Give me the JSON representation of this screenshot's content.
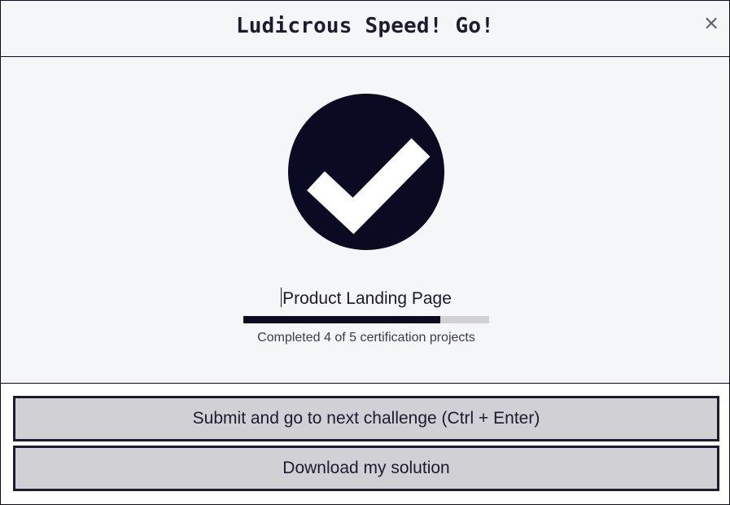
{
  "modal": {
    "title": "Ludicrous Speed! Go!",
    "close_label": "×"
  },
  "completion": {
    "icon": "check-circle-icon",
    "project_title": "Product Landing Page",
    "progress_completed": 4,
    "progress_total": 5,
    "progress_text": "Completed 4 of 5 certification projects"
  },
  "actions": {
    "submit_label": "Submit and go to next challenge (Ctrl + Enter)",
    "download_label": "Download my solution"
  },
  "colors": {
    "primary": "#0a0a23",
    "background": "#f5f6f7",
    "button_bg": "#d0d0d5",
    "progress_track": "#d0d0d5"
  }
}
